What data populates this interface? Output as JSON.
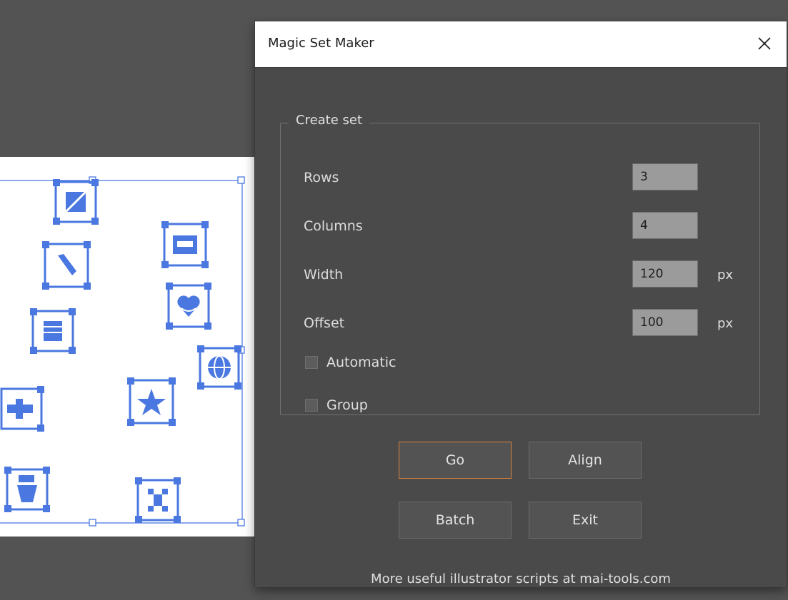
{
  "dialog": {
    "title": "Magic Set Maker",
    "panel_title": "Create set",
    "fields": {
      "rows": {
        "label": "Rows",
        "value": "3"
      },
      "columns": {
        "label": "Columns",
        "value": "4"
      },
      "width": {
        "label": "Width",
        "value": "120",
        "unit": "px"
      },
      "offset": {
        "label": "Offset",
        "value": "100",
        "unit": "px"
      }
    },
    "checkboxes": {
      "automatic": {
        "label": "Automatic",
        "checked": false
      },
      "group": {
        "label": "Group",
        "checked": false
      }
    },
    "buttons": {
      "go": "Go",
      "align": "Align",
      "batch": "Batch",
      "exit": "Exit"
    },
    "footer": "More useful illustrator scripts at mai-tools.com"
  },
  "colors": {
    "background": "#535353",
    "dialog_content": "#4a4a4a",
    "selection_blue": "#4a78e0",
    "default_button_border": "#d9803d"
  },
  "icons": {
    "artboard": [
      "x-box-icon",
      "tools-icon",
      "book-icon",
      "plug-icon",
      "robot-icon",
      "printer-icon",
      "heart-icon",
      "globe-icon",
      "star-icon",
      "drone-icon"
    ],
    "close": "close-icon"
  }
}
